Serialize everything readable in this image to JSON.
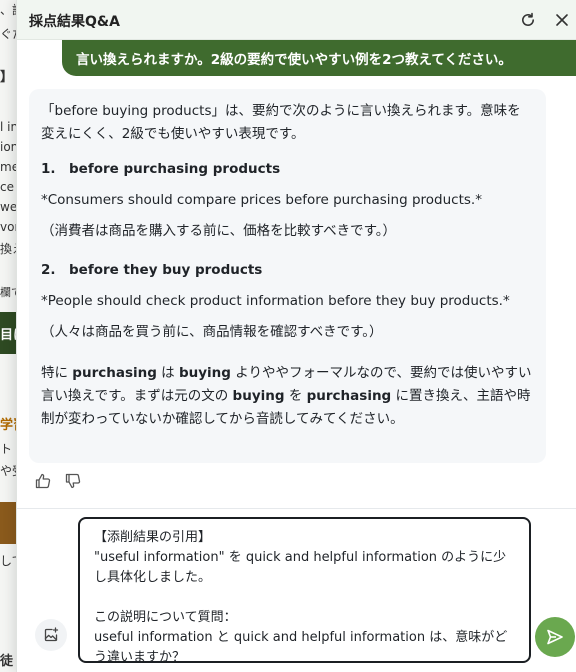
{
  "background_page": {
    "fragments": [
      "、説明",
      "ぐた",
      "】",
      "l in",
      "ion",
      "me",
      "ce",
      "we",
      "vor",
      "換え",
      "欄で",
      "目に",
      "学習",
      "ト",
      "や受",
      "して",
      "徒"
    ]
  },
  "header": {
    "title": "採点結果Q&A",
    "reload_icon": "reload-icon",
    "close_icon": "close-icon"
  },
  "user_message": {
    "text": "言い換えられますか。2級の要約で使いやすい例を2つ教えてください。"
  },
  "answer": {
    "intro_line1": "「before buying products」は、要約で次のように言い換えられます。意味を",
    "intro_line2": "変えにくく、2級でも使いやすい表現です。",
    "items": [
      {
        "num": "1.",
        "title": "before purchasing products",
        "example": "*Consumers should compare prices before purchasing products.*",
        "translation": "（消費者は商品を購入する前に、価格を比較すべきです。）"
      },
      {
        "num": "2.",
        "title": "before they buy products",
        "example": "*People should check product information before they buy products.*",
        "translation": "（人々は商品を買う前に、商品情報を確認すべきです。）"
      }
    ],
    "closing": {
      "p1": "特に ",
      "w1": "purchasing",
      "p2": " は ",
      "w2": "buying",
      "p3": " よりややフォーマルなので、要約では使いやすい",
      "line2_a": "言い換えです。まずは元の文の ",
      "w3": "buying",
      "line2_b": " を ",
      "w4": "purchasing",
      "line2_c": " に置き換え、主語や時",
      "line3": "制が変わっていないか確認してから音読してみてください。"
    }
  },
  "feedback": {
    "thumbs_up_icon": "thumbs-up-icon",
    "thumbs_down_icon": "thumbs-down-icon"
  },
  "composer": {
    "value": "【添削結果の引用】\n\"useful information\" を quick and helpful information のように少し具体化しました。\n\nこの説明について質問：\nuseful information と quick and helpful information は、意味がどう違いますか？",
    "attach_icon": "image-add-icon",
    "send_icon": "send-icon"
  },
  "colors": {
    "accent": "#3f6b2e",
    "send_button": "#6aa84f",
    "header_bg": "#f1f6f1",
    "answer_bg": "#f5f7f9"
  }
}
